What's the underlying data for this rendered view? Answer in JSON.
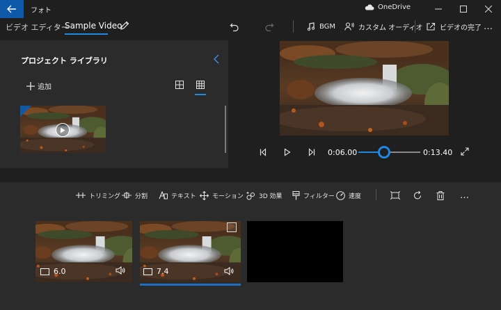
{
  "window": {
    "app_name": "フォト",
    "onedrive_label": "OneDrive"
  },
  "header": {
    "breadcrumb_root": "ビデオ エディター",
    "breadcrumb_separator": "›",
    "project_name": "Sample Video",
    "bgm_label": "BGM",
    "custom_audio_label": "カスタム オーディオ",
    "finish_label": "ビデオの完了",
    "more_label": "…"
  },
  "library": {
    "title": "プロジェクト ライブラリ",
    "add_label": "追加"
  },
  "player": {
    "current_time": "0:06.00",
    "total_time": "0:13.40",
    "progress": 0.42
  },
  "storyboard": {
    "tools": [
      {
        "name": "trim",
        "label": "トリミング"
      },
      {
        "name": "split",
        "label": "分割"
      },
      {
        "name": "text",
        "label": "テキスト"
      },
      {
        "name": "motion",
        "label": "モーション"
      },
      {
        "name": "3d-effects",
        "label": "3D 効果"
      },
      {
        "name": "filters",
        "label": "フィルター"
      },
      {
        "name": "speed",
        "label": "速度"
      }
    ],
    "clips": [
      {
        "duration": "6.0"
      },
      {
        "duration": "7.4"
      }
    ]
  },
  "colors": {
    "accent": "#1e88e5",
    "titlebar_back": "#0f5aa8",
    "panel": "#2b2b2b",
    "background": "#1f1f1f"
  }
}
